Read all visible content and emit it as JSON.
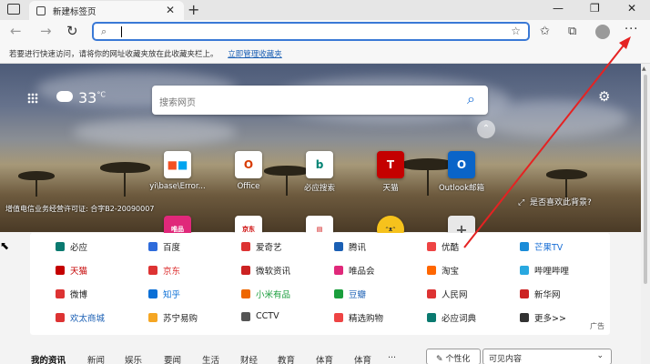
{
  "browser": {
    "tab_title": "新建标签页",
    "tab_close": "✕",
    "new_tab": "+",
    "win_min": "—",
    "win_restore": "❐",
    "win_close": "✕"
  },
  "nav": {
    "back": "←",
    "forward": "→",
    "reload": "↻",
    "search_glyph": "⌕",
    "fav_glyph": "☆",
    "favorites_glyph": "✩",
    "collections_glyph": "⧉",
    "more": "···"
  },
  "favbar": {
    "text": "若要进行快速访问，请将你的网址收藏夹放在此收藏夹栏上。",
    "link": "立即管理收藏夹"
  },
  "hero": {
    "temperature": "33",
    "temp_unit": "°C",
    "search_placeholder": "搜索网页",
    "search_glyph": "⌕",
    "gear_glyph": "⚙",
    "up_glyph": "⌃",
    "icp": "增值电信业务经营许可证: 合字B2-20090007",
    "like_bg": "是否喜欢此背景?",
    "expand_glyph": "⤢"
  },
  "quick_links": [
    {
      "label": "yi\\base\\Error..."
    },
    {
      "label": "Office"
    },
    {
      "label": "必应搜索"
    },
    {
      "label": "天猫"
    },
    {
      "label": "Outlook邮箱"
    }
  ],
  "links": [
    [
      "必应",
      "百度",
      "爱奇艺",
      "腾讯",
      "优酷",
      "芒果TV"
    ],
    [
      "天猫",
      "京东",
      "微软资讯",
      "唯品会",
      "淘宝",
      "哔哩哔哩"
    ],
    [
      "微博",
      "知乎",
      "小米有品",
      "豆瓣",
      "人民网",
      "新华网"
    ],
    [
      "欢太商城",
      "苏宁易购",
      "CCTV",
      "精选购物",
      "必应词典",
      "更多>>"
    ]
  ],
  "ad": "广告",
  "news": {
    "tabs": [
      "我的资讯",
      "新闻",
      "娱乐",
      "要闻",
      "生活",
      "财经",
      "教育",
      "体育",
      "体育"
    ],
    "ellipsis": "···",
    "personalize": "个性化",
    "visible": "可见内容"
  }
}
